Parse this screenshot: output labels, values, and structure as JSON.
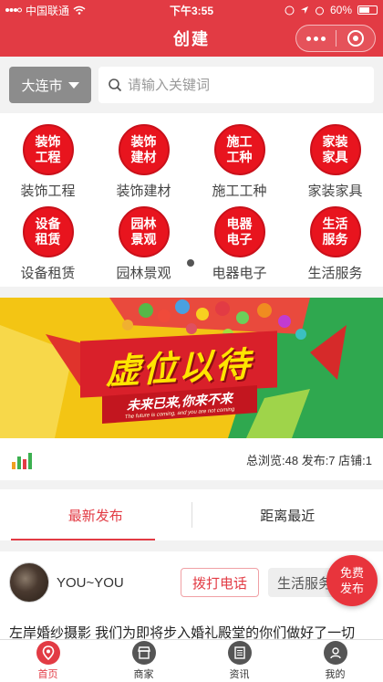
{
  "status_bar": {
    "carrier": "中国联通",
    "time": "下午3:55",
    "battery": "60%",
    "battery_level": 0.6
  },
  "nav": {
    "title": "创建"
  },
  "search": {
    "city": "大连市",
    "placeholder": "请输入关键词"
  },
  "categories": [
    {
      "icon_text": "装饰工程",
      "label": "装饰工程"
    },
    {
      "icon_text": "装饰建材",
      "label": "装饰建材"
    },
    {
      "icon_text": "施工工种",
      "label": "施工工种"
    },
    {
      "icon_text": "家装家具",
      "label": "家装家具"
    },
    {
      "icon_text": "设备租赁",
      "label": "设备租赁"
    },
    {
      "icon_text": "园林景观",
      "label": "园林景观"
    },
    {
      "icon_text": "电器电子",
      "label": "电器电子"
    },
    {
      "icon_text": "生活服务",
      "label": "生活服务"
    }
  ],
  "banner": {
    "headline": "虚位以待",
    "subline": "未来已来,你来不来",
    "tagline": "The future is coming, and you are not coming"
  },
  "stats": {
    "text": "总浏览:48 发布:7 店铺:1"
  },
  "tabs": [
    {
      "label": "最新发布"
    },
    {
      "label": "距离最近"
    }
  ],
  "post": {
    "username": "YOU~YOU",
    "call_label": "拨打电话",
    "tag": "生活服务",
    "text": "左岸婚纱摄影 我们为即将步入婚礼殿堂的你们做好了一切"
  },
  "fab": {
    "label": "免费发布"
  },
  "tab_bar": [
    {
      "label": "首页",
      "icon": "location-icon"
    },
    {
      "label": "商家",
      "icon": "store-icon"
    },
    {
      "label": "资讯",
      "icon": "news-icon"
    },
    {
      "label": "我的",
      "icon": "user-icon"
    }
  ],
  "colors": {
    "brand": "#e23b44",
    "category_red": "#e8141e",
    "city_select": "#8c8c8c"
  }
}
